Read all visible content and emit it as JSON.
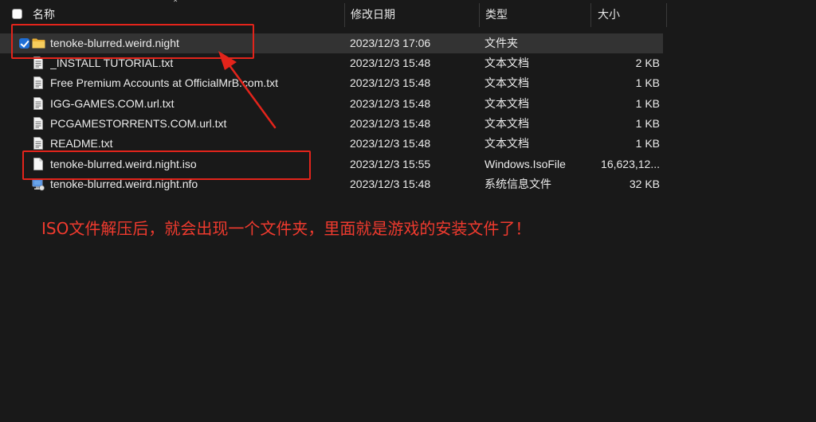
{
  "header": {
    "name": "名称",
    "date": "修改日期",
    "type": "类型",
    "size": "大小"
  },
  "rows": [
    {
      "name": "tenoke-blurred.weird.night",
      "date": "2023/12/3 17:06",
      "type": "文件夹",
      "size": "",
      "icon": "folder-icon",
      "selected": true
    },
    {
      "name": "_INSTALL TUTORIAL.txt",
      "date": "2023/12/3 15:48",
      "type": "文本文档",
      "size": "2 KB",
      "icon": "text-file-icon"
    },
    {
      "name": "Free Premium Accounts at OfficialMrB.com.txt",
      "date": "2023/12/3 15:48",
      "type": "文本文档",
      "size": "1 KB",
      "icon": "text-file-icon"
    },
    {
      "name": "IGG-GAMES.COM.url.txt",
      "date": "2023/12/3 15:48",
      "type": "文本文档",
      "size": "1 KB",
      "icon": "text-file-icon"
    },
    {
      "name": "PCGAMESTORRENTS.COM.url.txt",
      "date": "2023/12/3 15:48",
      "type": "文本文档",
      "size": "1 KB",
      "icon": "text-file-icon"
    },
    {
      "name": "README.txt",
      "date": "2023/12/3 15:48",
      "type": "文本文档",
      "size": "1 KB",
      "icon": "text-file-icon"
    },
    {
      "name": "tenoke-blurred.weird.night.iso",
      "date": "2023/12/3 15:55",
      "type": "Windows.IsoFile",
      "size": "16,623,12...",
      "icon": "iso-file-icon"
    },
    {
      "name": "tenoke-blurred.weird.night.nfo",
      "date": "2023/12/3 15:48",
      "type": "系统信息文件",
      "size": "32 KB",
      "icon": "nfo-file-icon"
    }
  ],
  "annotation": {
    "caption": "ISO文件解压后，就会出现一个文件夹，里面就是游戏的安装文件了！",
    "color": "#e3241b"
  },
  "colors": {
    "background": "#191919",
    "selected_row": "#333333",
    "checkbox_accent": "#1f6fd6",
    "folder": "#f2c14e"
  }
}
